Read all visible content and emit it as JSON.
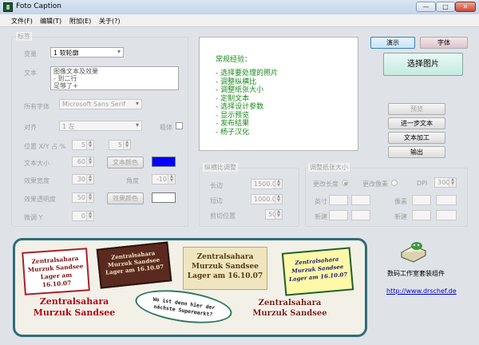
{
  "window": {
    "title": "Foto Caption",
    "buttons": {
      "minimize": "—",
      "maximize": "□",
      "close": "✕"
    }
  },
  "menu": [
    {
      "label": "文件(F)"
    },
    {
      "label": "编辑(T)"
    },
    {
      "label": "附加(E)"
    },
    {
      "label": "关于(?)"
    }
  ],
  "label_group": {
    "title": "标签",
    "variable_label": "变量",
    "variable_value": "1 软轮廓",
    "text_label": "文本",
    "text_lines": [
      "图像文本及效果",
      "- 到二行",
      "足够了+"
    ],
    "font_label": "所有字体",
    "font_value": "Microsoft Sans Serif",
    "align_label": "对齐",
    "align_value": "1 左",
    "bold_label": "粗体",
    "pos_label": "位置 X/Y 占 %",
    "pos_x": "5",
    "pos_y": "5",
    "size_label": "文本大小",
    "size_value": "60",
    "text_color_button": "文本颜色",
    "text_color": "#0000ff",
    "effect_width_label": "效果宽度",
    "effect_width_value": "30",
    "angle_label": "角度",
    "angle_value": "-10",
    "effect_opacity_label": "效果透明度",
    "effect_opacity_value": "50",
    "effect_color_button": "效果颜色",
    "effect_color": "#ffffff",
    "fine_y_label": "微调 Y",
    "fine_y_value": "0"
  },
  "notes": {
    "heading": "常规经验：",
    "items": [
      "- 选择要处理的照片",
      "- 调整纵横比",
      "- 调整纸张大小",
      "- 定制文本",
      "- 选择设计参数",
      "- 显示预览",
      "- 发布结果",
      "- 杨子汉化"
    ]
  },
  "aspect_group": {
    "title": "纵横比调整",
    "long_label": "长边",
    "long_value": "1500.00",
    "short_label": "短边",
    "short_value": "1000.00",
    "crop_label": "剪切位置",
    "crop_value": "50"
  },
  "paper_group": {
    "title": "调整纸张大小",
    "change_length_label": "更改长度",
    "change_pixel_label": "更改像素",
    "dpi_label": "DPI",
    "dpi_value": "300",
    "inch_label": "英寸",
    "pixel_label": "像素",
    "new_label": "新建"
  },
  "right_panel": {
    "demo_button": "演示",
    "font_button": "字体",
    "select_image_button": "选择图片",
    "preview_button": "预览",
    "next_text_button": "进一步文本",
    "text_process_button": "文本加工",
    "output_button": "输出",
    "vendor_text": "数码工作室套装组件",
    "vendor_url": "http://www.drschef.de"
  },
  "preview": {
    "sample1": [
      "Zentralsahara",
      "Murzuk Sandsee",
      "Lager am 16.10.07"
    ],
    "sample2": [
      "Zentralsahara",
      "Murzuk Sandsee",
      "Lager am 16.10.07"
    ],
    "sample3": [
      "Zentralsahara",
      "Murzuk Sandsee",
      "Lager am 16.10.07"
    ],
    "sample4": [
      "Zentralsahara",
      "Murzuk Sandsee",
      "Lager am 16.10.07"
    ],
    "sample5": [
      "Zentralsahara",
      "Murzuk Sandsee"
    ],
    "sample6": [
      "Wo ist denn hier der",
      "nächste Supermarkt?"
    ],
    "sample7": [
      "Zentralsahara",
      "Murzuk Sandsee"
    ]
  }
}
